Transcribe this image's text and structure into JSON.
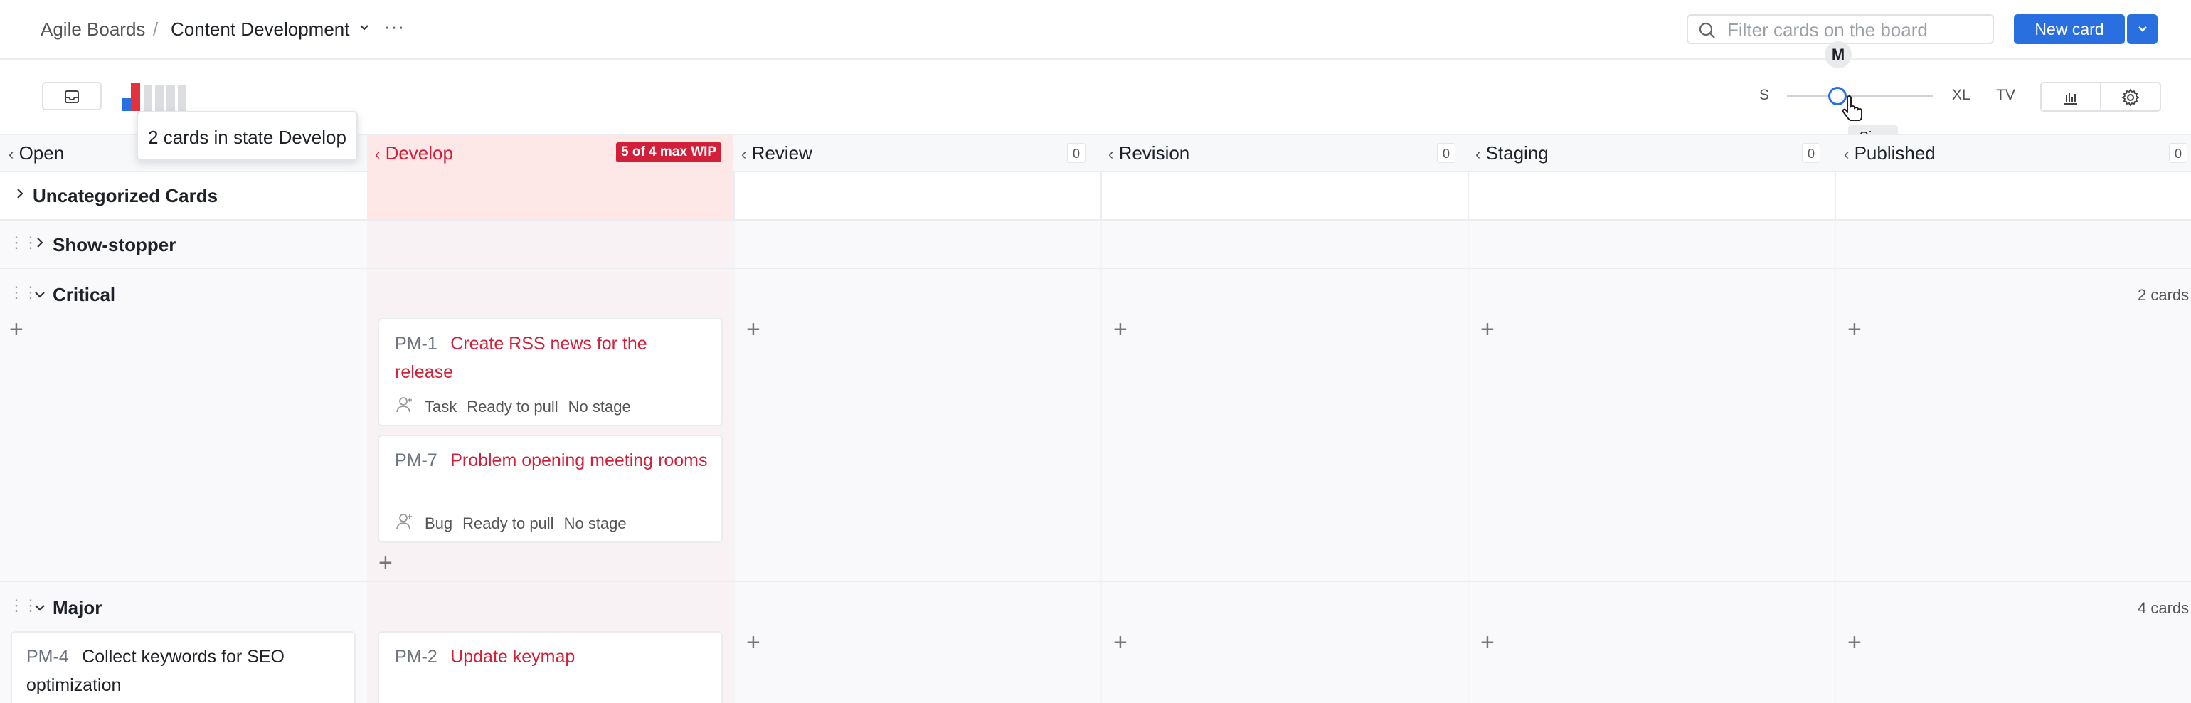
{
  "header": {
    "breadcrumb_root": "Agile Boards",
    "separator": "/",
    "board_name": "Content Development",
    "more_label": "···",
    "search_placeholder": "Filter cards on the board",
    "new_card_label": "New card"
  },
  "toolbar": {
    "tooltip_develop": "2 cards in state Develop",
    "size_labels": {
      "s": "S",
      "m": "M",
      "xl": "XL",
      "tv": "TV"
    },
    "size_value": "M",
    "size_tooltip": "Size"
  },
  "columns": [
    {
      "name": "Open",
      "count": ""
    },
    {
      "name": "Develop",
      "wip": "5 of 4 max WIP"
    },
    {
      "name": "Review",
      "count": "0"
    },
    {
      "name": "Revision",
      "count": "0"
    },
    {
      "name": "Staging",
      "count": "0"
    },
    {
      "name": "Published",
      "count": "0"
    }
  ],
  "swimlanes": {
    "uncategorized": "Uncategorized Cards",
    "showstopper": "Show-stopper",
    "critical": {
      "title": "Critical",
      "count": "2 cards"
    },
    "major": {
      "title": "Major",
      "count": "4 cards"
    }
  },
  "cards": {
    "pm1": {
      "id": "PM-1",
      "title": "Create RSS news for the release",
      "type": "Task",
      "state": "Ready to pull",
      "stage": "No stage"
    },
    "pm7": {
      "id": "PM-7",
      "title": "Problem opening meeting rooms",
      "type": "Bug",
      "state": "Ready to pull",
      "stage": "No stage"
    },
    "pm4": {
      "id": "PM-4",
      "title": "Collect keywords for SEO optimization"
    },
    "pm2": {
      "id": "PM-2",
      "title": "Update keymap"
    }
  },
  "colors": {
    "accent": "#2a6fe0",
    "wip_red": "#d3203a",
    "develop_bg": "#fde7e7"
  }
}
